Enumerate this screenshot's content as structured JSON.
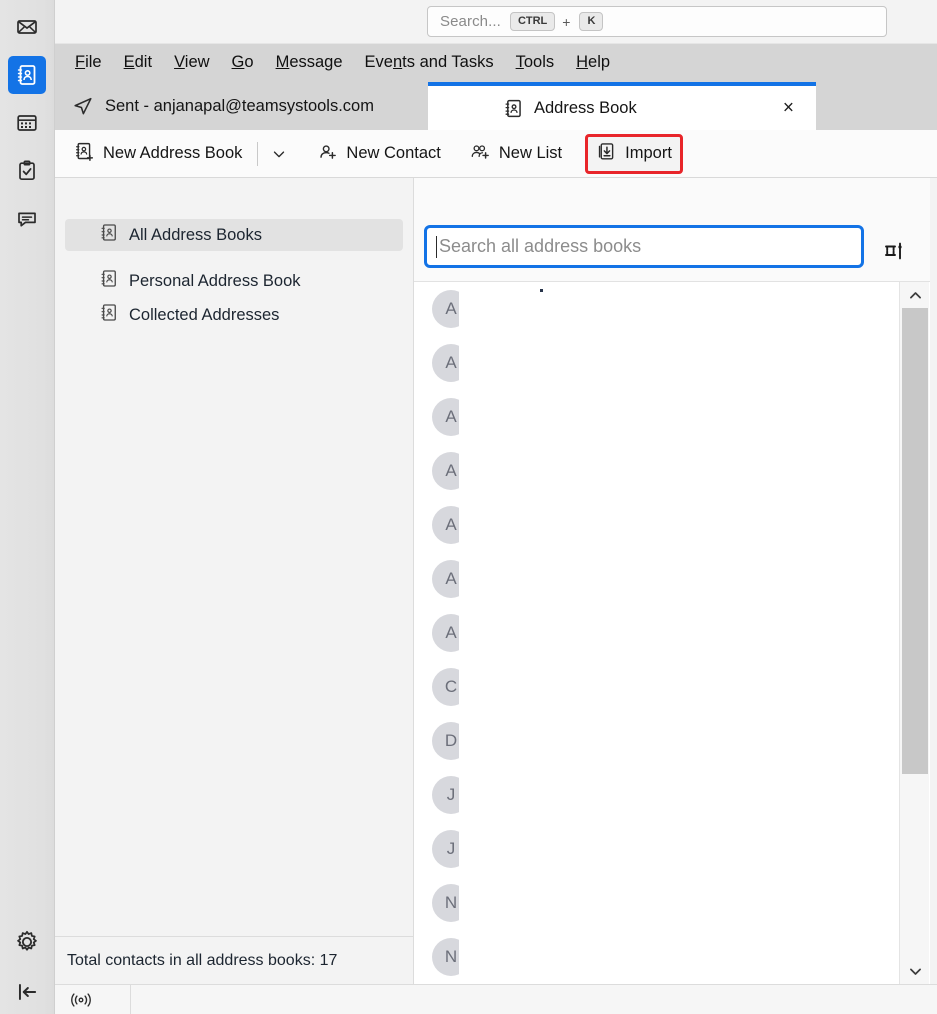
{
  "window": {
    "global_search": {
      "placeholder": "Search...",
      "shortcut_mod": "CTRL",
      "shortcut_plus": "+",
      "shortcut_key": "K"
    }
  },
  "rail": {
    "items": [
      {
        "name": "mail-icon",
        "label": "Mail",
        "active": false
      },
      {
        "name": "address-book-icon",
        "label": "Address Book",
        "active": true
      },
      {
        "name": "calendar-icon",
        "label": "Calendar",
        "active": false
      },
      {
        "name": "tasks-icon",
        "label": "Tasks",
        "active": false
      },
      {
        "name": "chat-icon",
        "label": "Chat",
        "active": false
      }
    ],
    "settings_label": "Settings",
    "collapse_label": "Collapse"
  },
  "menubar": {
    "items": [
      {
        "pre": "",
        "acc": "F",
        "post": "ile"
      },
      {
        "pre": "",
        "acc": "E",
        "post": "dit"
      },
      {
        "pre": "",
        "acc": "V",
        "post": "iew"
      },
      {
        "pre": "",
        "acc": "G",
        "post": "o"
      },
      {
        "pre": "",
        "acc": "M",
        "post": "essage"
      },
      {
        "pre": "Eve",
        "acc": "n",
        "post": "ts and Tasks"
      },
      {
        "pre": "",
        "acc": "T",
        "post": "ools"
      },
      {
        "pre": "",
        "acc": "H",
        "post": "elp"
      }
    ],
    "plain": [
      "File",
      "Edit",
      "View",
      "Go",
      "Message",
      "Events and Tasks",
      "Tools",
      "Help"
    ]
  },
  "tabs": {
    "inactive": {
      "label": "Sent - anjanapal@teamsystools.com",
      "icon": "sent-paper-plane-icon"
    },
    "active": {
      "label": "Address Book",
      "icon": "address-book-icon",
      "close": "×"
    }
  },
  "toolbar": {
    "new_address_book": "New Address Book",
    "new_address_book_caret": "⌄",
    "new_contact": "New Contact",
    "new_list": "New List",
    "import": "Import",
    "highlight_color": "#e8252a"
  },
  "books": {
    "items": [
      {
        "label": "All Address Books",
        "selected": true,
        "indent": false
      },
      {
        "label": "Personal Address Book",
        "selected": false,
        "indent": true
      },
      {
        "label": "Collected Addresses",
        "selected": false,
        "indent": true
      }
    ]
  },
  "status": {
    "total_contacts": "Total contacts in all address books: 17"
  },
  "contacts_pane": {
    "search_placeholder": "Search all address books",
    "display_options_icon": "display-options-icon",
    "rows": [
      {
        "initial": "A"
      },
      {
        "initial": "A"
      },
      {
        "initial": "A"
      },
      {
        "initial": "A"
      },
      {
        "initial": "A"
      },
      {
        "initial": "A"
      },
      {
        "initial": "A"
      },
      {
        "initial": "C"
      },
      {
        "initial": "D"
      },
      {
        "initial": "J"
      },
      {
        "initial": "J"
      },
      {
        "initial": "N"
      },
      {
        "initial": "N"
      }
    ]
  },
  "colors": {
    "accent_blue": "#1373e6",
    "highlight_red": "#e8252a",
    "avatar_bg": "#d7d8dd",
    "menubar_bg": "#d5d5d5"
  }
}
